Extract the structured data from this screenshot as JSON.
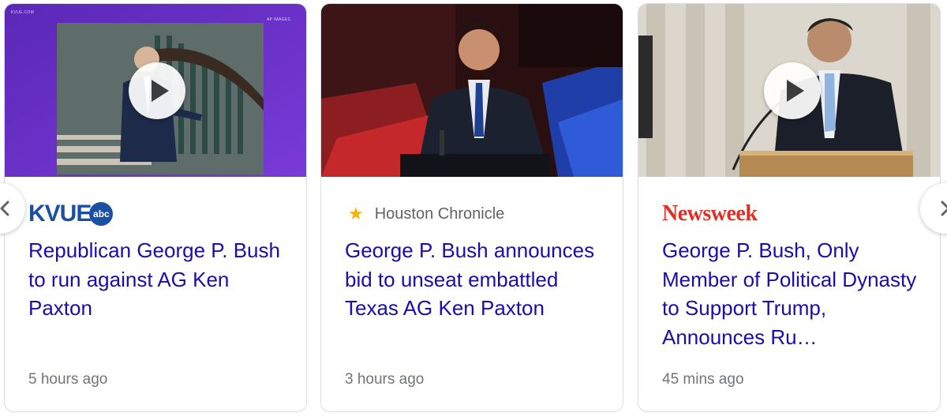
{
  "cards": [
    {
      "source": {
        "wordmark": "KVUE",
        "badge": "abc"
      },
      "headline": "Republican George P. Bush to run against AG Ken Paxton",
      "time": "5 hours ago",
      "has_video": true,
      "thumb_labels": {
        "left": "KVUE.COM",
        "right": "AP IMAGES"
      }
    },
    {
      "source": {
        "name": "Houston Chronicle",
        "icon": "star-icon"
      },
      "headline": "George P. Bush announces bid to unseat embattled Texas AG Ken Paxton",
      "time": "3 hours ago",
      "has_video": false
    },
    {
      "source": {
        "wordmark": "Newsweek"
      },
      "headline": "George P. Bush, Only Member of Political Dynasty to Support Trump, Announces Ru…",
      "time": "45 mins ago",
      "has_video": true
    }
  ],
  "nav": {
    "prev_icon": "chevron-left-icon",
    "next_icon": "chevron-right-icon"
  },
  "colors": {
    "headline": "#1a0dab",
    "meta": "#70757a",
    "kvue": "#1a4fa3",
    "newsweek": "#e02f24",
    "star": "#f4b400",
    "thumb1_bg": "#6a30c9"
  }
}
